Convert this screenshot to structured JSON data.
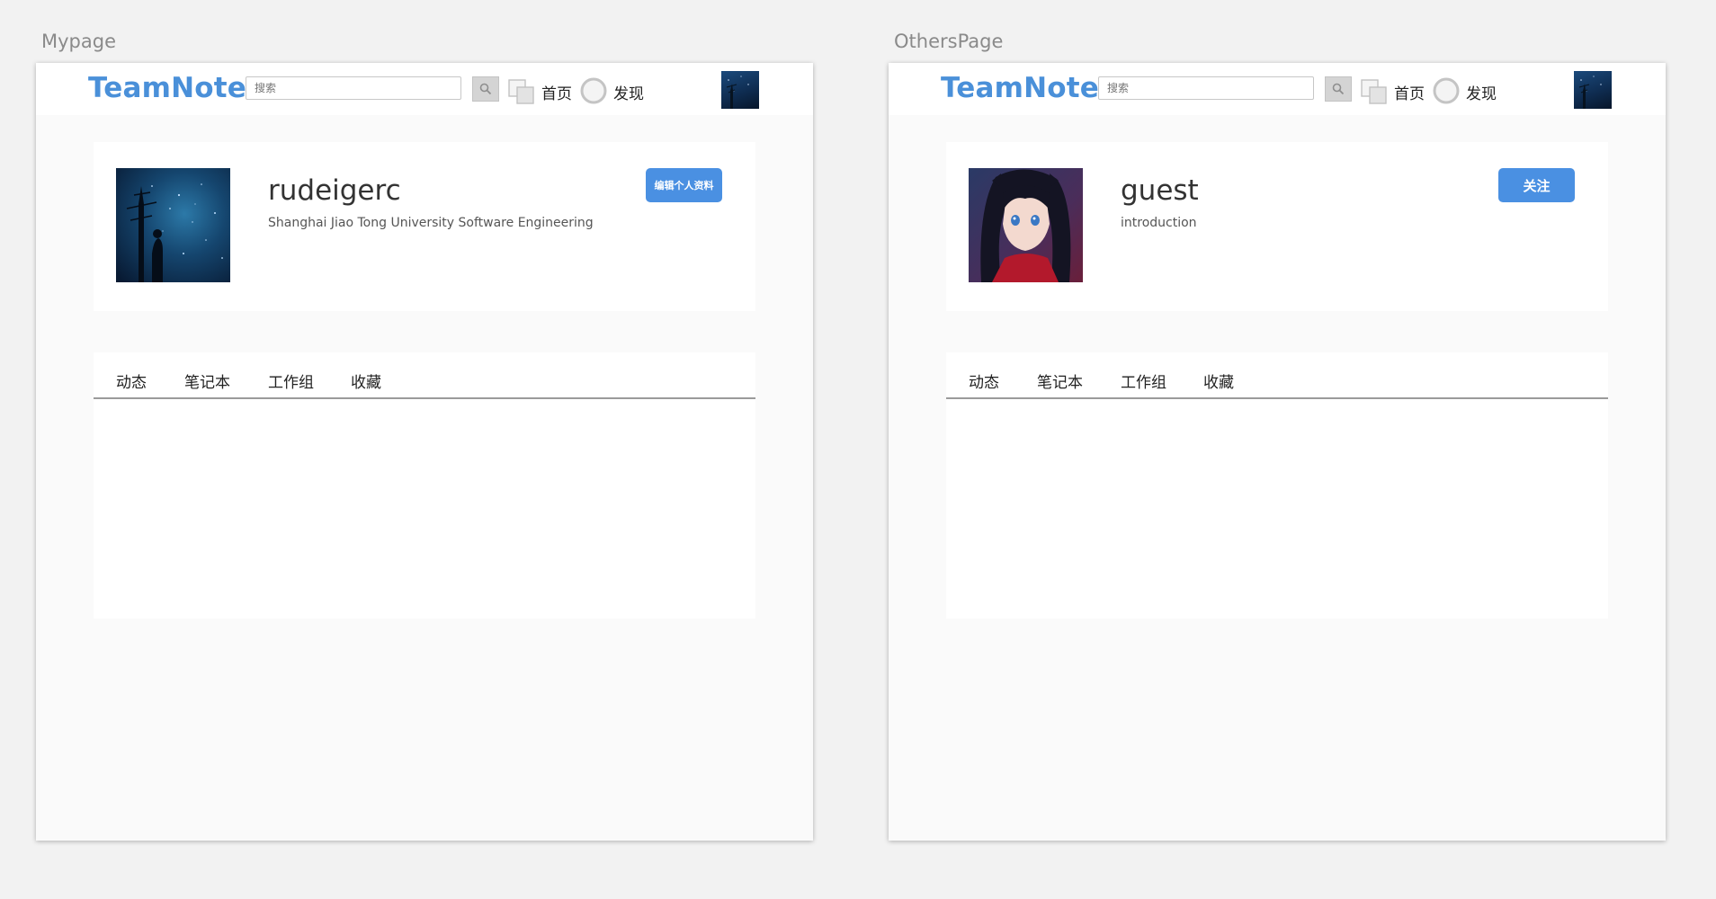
{
  "artboards": {
    "mypage": {
      "label": "Mypage",
      "logo": "TeamNote",
      "search_placeholder": "搜索",
      "nav_home": "首页",
      "nav_discover": "发现",
      "profile": {
        "name": "rudeigerc",
        "intro": "Shanghai Jiao Tong University Software Engineering",
        "action_label": "编辑个人资料"
      },
      "tabs": [
        "动态",
        "笔记本",
        "工作组",
        "收藏"
      ]
    },
    "otherspage": {
      "label": "OthersPage",
      "logo": "TeamNote",
      "search_placeholder": "搜索",
      "nav_home": "首页",
      "nav_discover": "发现",
      "profile": {
        "name": "guest",
        "intro": "introduction",
        "action_label": "关注"
      },
      "tabs": [
        "动态",
        "笔记本",
        "工作组",
        "收藏"
      ]
    }
  },
  "colors": {
    "accent": "#4a90e2",
    "logo": "#4a90d9",
    "background": "#f2f2f2",
    "artboard_bg": "#fafafa"
  },
  "icons": {
    "search": "search-icon",
    "home": "home-squares-icon",
    "discover": "circle-icon"
  }
}
